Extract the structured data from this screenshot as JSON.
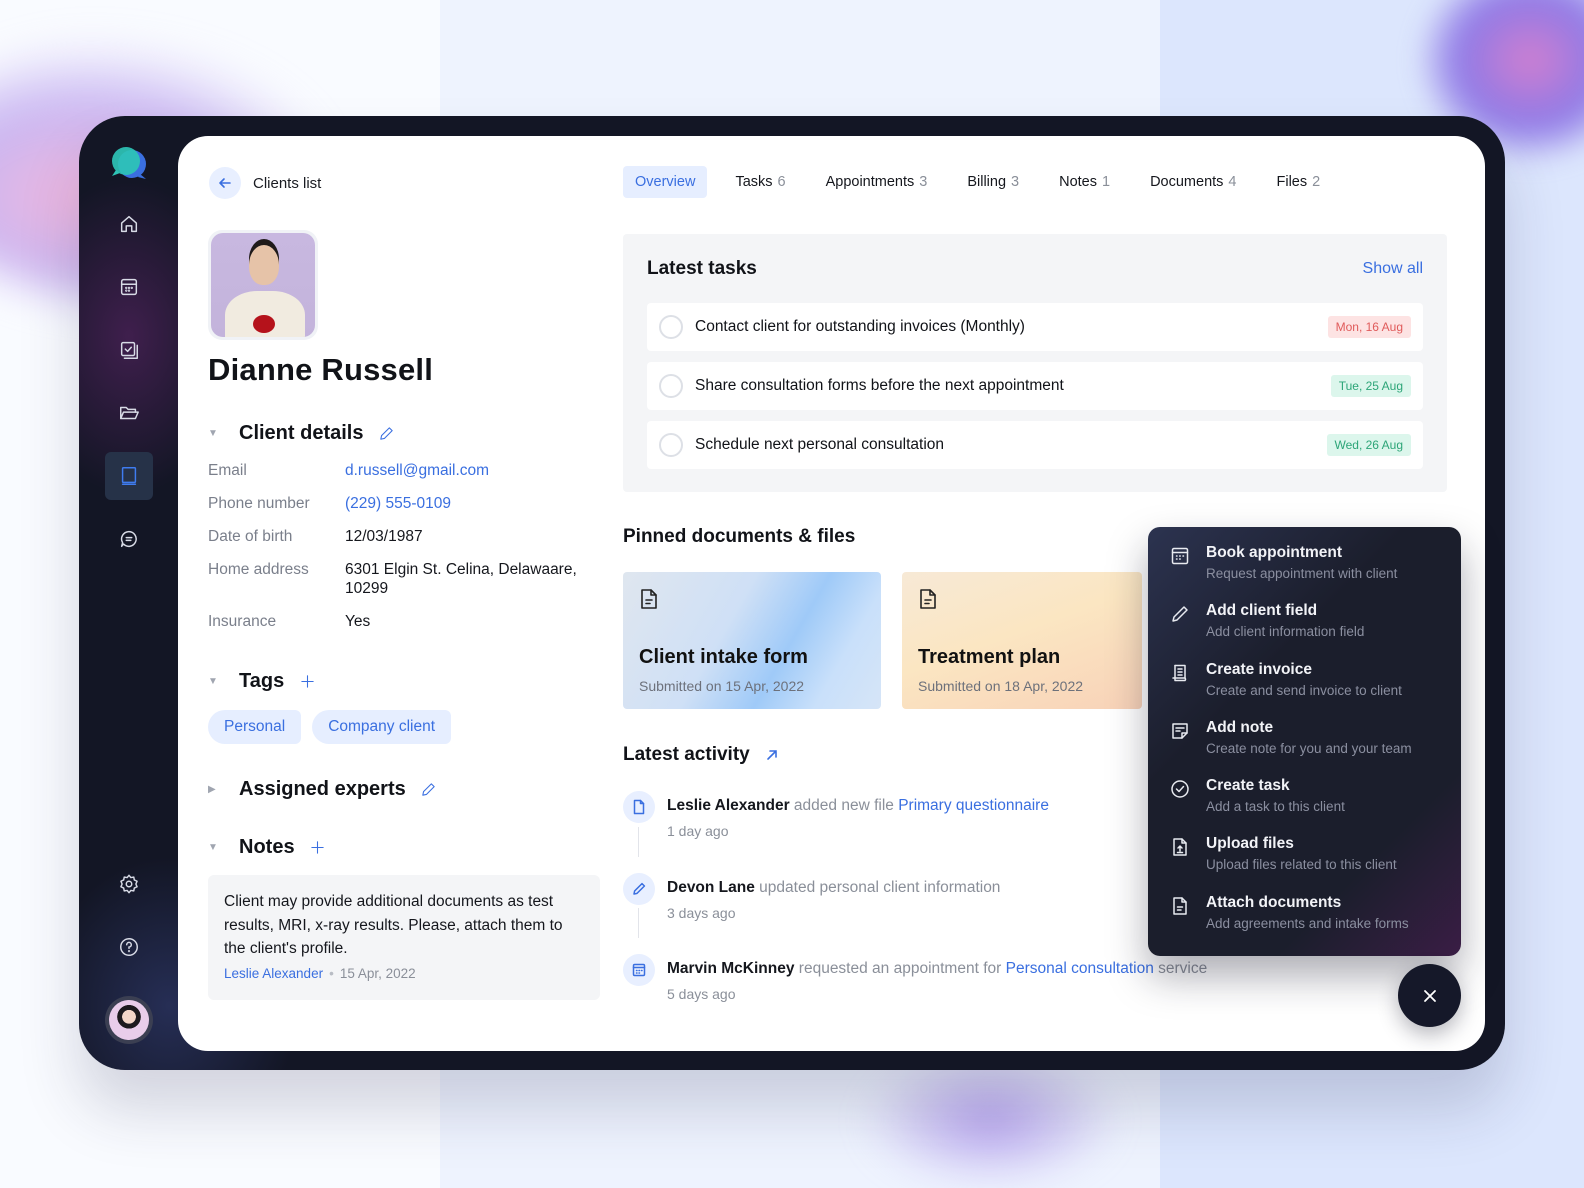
{
  "header": {
    "back_label": "Clients list"
  },
  "client": {
    "name": "Dianne Russell"
  },
  "tabs": [
    {
      "label": "Overview",
      "count": "",
      "active": true
    },
    {
      "label": "Tasks",
      "count": "6"
    },
    {
      "label": "Appointments",
      "count": "3"
    },
    {
      "label": "Billing",
      "count": "3"
    },
    {
      "label": "Notes",
      "count": "1"
    },
    {
      "label": "Documents",
      "count": "4"
    },
    {
      "label": "Files",
      "count": "2"
    }
  ],
  "sections": {
    "client_details": "Client details",
    "tags": "Tags",
    "assigned_experts": "Assigned experts",
    "notes": "Notes"
  },
  "details": [
    {
      "label": "Email",
      "value": "d.russell@gmail.com"
    },
    {
      "label": "Phone number",
      "value": "(229) 555-0109"
    },
    {
      "label": "Date of birth",
      "value": "12/03/1987"
    },
    {
      "label": "Home address",
      "value": "6301 Elgin St. Celina, Delawaare, 10299"
    },
    {
      "label": "Insurance",
      "value": "Yes"
    }
  ],
  "tags": [
    "Personal",
    "Company client"
  ],
  "note": {
    "text": "Client may provide additional documents as test results, MRI, x-ray results. Please, attach them to the client's profile.",
    "author": "Leslie Alexander",
    "date": "15 Apr, 2022"
  },
  "latest_tasks": {
    "title": "Latest tasks",
    "show_all": "Show all",
    "items": [
      {
        "text": "Contact client for outstanding invoices (Monthly)",
        "date": "Mon, 16 Aug",
        "status_color": "#e05b5b"
      },
      {
        "text": "Share consultation forms before the next appointment",
        "date": "Tue, 25 Aug",
        "status_color": "#2da578"
      },
      {
        "text": "Schedule next personal consultation",
        "date": "Wed, 26 Aug",
        "status_color": "#2da578"
      }
    ]
  },
  "pinned": {
    "title": "Pinned documents & files",
    "items": [
      {
        "name": "Client intake form",
        "sub": "Submitted on 15 Apr, 2022",
        "icon": "document-icon"
      },
      {
        "name": "Treatment plan",
        "sub": "Submitted on 18 Apr, 2022",
        "icon": "document-icon"
      }
    ]
  },
  "activity": {
    "title": "Latest activity",
    "items": [
      {
        "who": "Leslie Alexander",
        "action": " added new file ",
        "link": "Primary questionnaire",
        "tail": "",
        "when": "1 day ago",
        "icon": "file-icon"
      },
      {
        "who": "Devon Lane",
        "action": " updated personal client information",
        "link": "",
        "tail": "",
        "when": "3 days ago",
        "icon": "pencil-icon"
      },
      {
        "who": "Marvin McKinney",
        "action": " requested an appointment for ",
        "link": "Personal consultation",
        "tail": " service",
        "when": "5 days ago",
        "icon": "calendar-icon"
      }
    ]
  },
  "quick_menu": [
    {
      "title": "Book appointment",
      "sub": "Request appointment with client",
      "icon": "calendar-icon"
    },
    {
      "title": "Add client field",
      "sub": "Add client information field",
      "icon": "pencil-icon"
    },
    {
      "title": "Create invoice",
      "sub": "Create and send invoice to client",
      "icon": "invoice-icon"
    },
    {
      "title": "Add note",
      "sub": "Create note for you and your team",
      "icon": "note-icon"
    },
    {
      "title": "Create task",
      "sub": "Add a task to this client",
      "icon": "check-circle-icon"
    },
    {
      "title": "Upload files",
      "sub": "Upload files related to this client",
      "icon": "file-upload-icon"
    },
    {
      "title": "Attach documents",
      "sub": "Add agreements and intake forms",
      "icon": "document-icon"
    }
  ],
  "colors": {
    "accent": "#3a6fe0",
    "sidebar_bg": "#131625",
    "overdue": "#e05b5b",
    "upcoming": "#2da578"
  }
}
